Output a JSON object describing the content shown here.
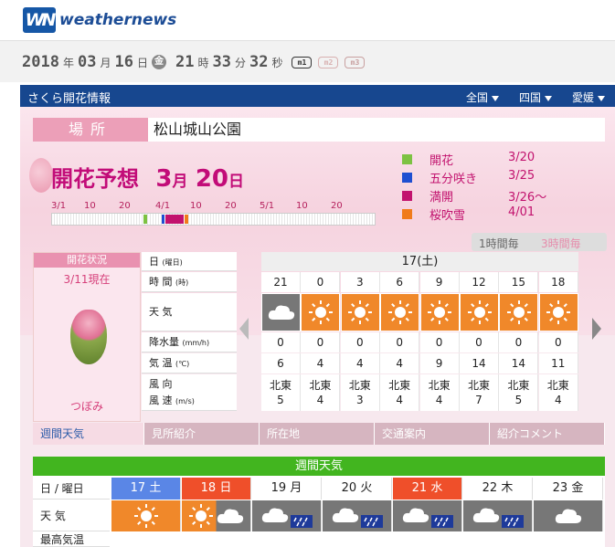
{
  "brand": {
    "mark": "WN",
    "name": "weathernews",
    "color": "#1657a6"
  },
  "datetime": {
    "year": "2018",
    "y_unit": "年",
    "month": "03",
    "m_unit": "月",
    "day": "16",
    "d_unit": "日",
    "weekday": "金",
    "hour": "21",
    "h_unit": "時",
    "minute": "33",
    "mi_unit": "分",
    "second": "32",
    "s_unit": "秒",
    "modes": [
      "m1",
      "m2",
      "m3"
    ]
  },
  "header": {
    "title": "さくら開花情報",
    "regions": [
      "全国",
      "四国",
      "愛媛"
    ]
  },
  "location": {
    "label": "場所",
    "name": "松山城山公園"
  },
  "forecast": {
    "label": "開花予想",
    "month": "3",
    "month_unit": "月",
    "day": "20",
    "day_unit": "日"
  },
  "scale_ticks": [
    "3/1",
    "10",
    "20",
    "4/1",
    "10",
    "20",
    "5/1",
    "10",
    "20"
  ],
  "legend": [
    {
      "label": "開花",
      "date": "3/20",
      "color": "#7dc242"
    },
    {
      "label": "五分咲き",
      "date": "3/25",
      "color": "#1f4fd1"
    },
    {
      "label": "満開",
      "date": "3/26〜",
      "color": "#c2126e"
    },
    {
      "label": "桜吹雪",
      "date": "4/01",
      "color": "#f07b1b"
    }
  ],
  "interval": {
    "option1": "1時間毎",
    "option2": "3時間毎"
  },
  "status": {
    "header": "開花状況",
    "date": "3/11現在",
    "stage": "つぼみ"
  },
  "row_labels": {
    "day": "日",
    "day_unit": "(曜日)",
    "time": "時 間",
    "time_unit": "(時)",
    "weather": "天 気",
    "rain": "降水量",
    "rain_unit": "(mm/h)",
    "temp": "気 温",
    "temp_unit": "(℃)",
    "wind": "風 向\n風 速",
    "wind_unit": "(m/s)"
  },
  "hourly": {
    "day": "17(土)",
    "times": [
      "21",
      "0",
      "3",
      "6",
      "9",
      "12",
      "15",
      "18"
    ],
    "weather": [
      "cloudy",
      "sunny",
      "sunny",
      "sunny",
      "sunny",
      "sunny",
      "sunny",
      "sunny"
    ],
    "rain": [
      "0",
      "0",
      "0",
      "0",
      "0",
      "0",
      "0",
      "0"
    ],
    "temp": [
      "6",
      "4",
      "4",
      "4",
      "9",
      "14",
      "14",
      "11"
    ],
    "wind_dir": [
      "北東",
      "北東",
      "北東",
      "北東",
      "北東",
      "北東",
      "北東",
      "北東"
    ],
    "wind_speed": [
      "5",
      "4",
      "3",
      "4",
      "4",
      "7",
      "5",
      "4"
    ]
  },
  "tabs": [
    "週間天気",
    "見所紹介",
    "所在地",
    "交通案内",
    "紹介コメント"
  ],
  "weekly": {
    "title": "週間天気",
    "label_day": "日 / 曜日",
    "label_weather": "天 気",
    "label_temp": "最高気温",
    "days": [
      {
        "label": "17 土",
        "color": "#5a86e6",
        "weather": "sunny"
      },
      {
        "label": "18 日",
        "color": "#ef4f2a",
        "weather": "sun-cloud"
      },
      {
        "label": "19 月",
        "color": "#ffffff",
        "weather": "cloud-rain"
      },
      {
        "label": "20 火",
        "color": "#ffffff",
        "weather": "cloud-rain"
      },
      {
        "label": "21 水",
        "color": "#ef4f2a",
        "weather": "cloud-rain"
      },
      {
        "label": "22 木",
        "color": "#ffffff",
        "weather": "cloud-rain"
      },
      {
        "label": "23 金",
        "color": "#ffffff",
        "weather": "cloudy"
      }
    ]
  }
}
